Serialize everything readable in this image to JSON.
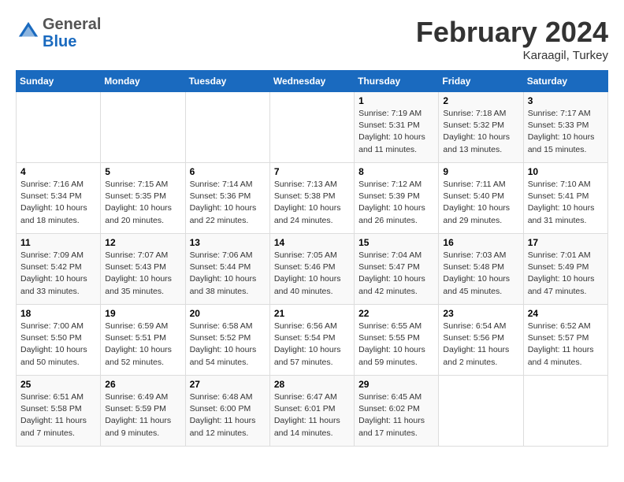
{
  "header": {
    "logo_line1": "General",
    "logo_line2": "Blue",
    "month_title": "February 2024",
    "location": "Karaagil, Turkey"
  },
  "days_of_week": [
    "Sunday",
    "Monday",
    "Tuesday",
    "Wednesday",
    "Thursday",
    "Friday",
    "Saturday"
  ],
  "weeks": [
    [
      {
        "num": "",
        "info": ""
      },
      {
        "num": "",
        "info": ""
      },
      {
        "num": "",
        "info": ""
      },
      {
        "num": "",
        "info": ""
      },
      {
        "num": "1",
        "info": "Sunrise: 7:19 AM\nSunset: 5:31 PM\nDaylight: 10 hours\nand 11 minutes."
      },
      {
        "num": "2",
        "info": "Sunrise: 7:18 AM\nSunset: 5:32 PM\nDaylight: 10 hours\nand 13 minutes."
      },
      {
        "num": "3",
        "info": "Sunrise: 7:17 AM\nSunset: 5:33 PM\nDaylight: 10 hours\nand 15 minutes."
      }
    ],
    [
      {
        "num": "4",
        "info": "Sunrise: 7:16 AM\nSunset: 5:34 PM\nDaylight: 10 hours\nand 18 minutes."
      },
      {
        "num": "5",
        "info": "Sunrise: 7:15 AM\nSunset: 5:35 PM\nDaylight: 10 hours\nand 20 minutes."
      },
      {
        "num": "6",
        "info": "Sunrise: 7:14 AM\nSunset: 5:36 PM\nDaylight: 10 hours\nand 22 minutes."
      },
      {
        "num": "7",
        "info": "Sunrise: 7:13 AM\nSunset: 5:38 PM\nDaylight: 10 hours\nand 24 minutes."
      },
      {
        "num": "8",
        "info": "Sunrise: 7:12 AM\nSunset: 5:39 PM\nDaylight: 10 hours\nand 26 minutes."
      },
      {
        "num": "9",
        "info": "Sunrise: 7:11 AM\nSunset: 5:40 PM\nDaylight: 10 hours\nand 29 minutes."
      },
      {
        "num": "10",
        "info": "Sunrise: 7:10 AM\nSunset: 5:41 PM\nDaylight: 10 hours\nand 31 minutes."
      }
    ],
    [
      {
        "num": "11",
        "info": "Sunrise: 7:09 AM\nSunset: 5:42 PM\nDaylight: 10 hours\nand 33 minutes."
      },
      {
        "num": "12",
        "info": "Sunrise: 7:07 AM\nSunset: 5:43 PM\nDaylight: 10 hours\nand 35 minutes."
      },
      {
        "num": "13",
        "info": "Sunrise: 7:06 AM\nSunset: 5:44 PM\nDaylight: 10 hours\nand 38 minutes."
      },
      {
        "num": "14",
        "info": "Sunrise: 7:05 AM\nSunset: 5:46 PM\nDaylight: 10 hours\nand 40 minutes."
      },
      {
        "num": "15",
        "info": "Sunrise: 7:04 AM\nSunset: 5:47 PM\nDaylight: 10 hours\nand 42 minutes."
      },
      {
        "num": "16",
        "info": "Sunrise: 7:03 AM\nSunset: 5:48 PM\nDaylight: 10 hours\nand 45 minutes."
      },
      {
        "num": "17",
        "info": "Sunrise: 7:01 AM\nSunset: 5:49 PM\nDaylight: 10 hours\nand 47 minutes."
      }
    ],
    [
      {
        "num": "18",
        "info": "Sunrise: 7:00 AM\nSunset: 5:50 PM\nDaylight: 10 hours\nand 50 minutes."
      },
      {
        "num": "19",
        "info": "Sunrise: 6:59 AM\nSunset: 5:51 PM\nDaylight: 10 hours\nand 52 minutes."
      },
      {
        "num": "20",
        "info": "Sunrise: 6:58 AM\nSunset: 5:52 PM\nDaylight: 10 hours\nand 54 minutes."
      },
      {
        "num": "21",
        "info": "Sunrise: 6:56 AM\nSunset: 5:54 PM\nDaylight: 10 hours\nand 57 minutes."
      },
      {
        "num": "22",
        "info": "Sunrise: 6:55 AM\nSunset: 5:55 PM\nDaylight: 10 hours\nand 59 minutes."
      },
      {
        "num": "23",
        "info": "Sunrise: 6:54 AM\nSunset: 5:56 PM\nDaylight: 11 hours\nand 2 minutes."
      },
      {
        "num": "24",
        "info": "Sunrise: 6:52 AM\nSunset: 5:57 PM\nDaylight: 11 hours\nand 4 minutes."
      }
    ],
    [
      {
        "num": "25",
        "info": "Sunrise: 6:51 AM\nSunset: 5:58 PM\nDaylight: 11 hours\nand 7 minutes."
      },
      {
        "num": "26",
        "info": "Sunrise: 6:49 AM\nSunset: 5:59 PM\nDaylight: 11 hours\nand 9 minutes."
      },
      {
        "num": "27",
        "info": "Sunrise: 6:48 AM\nSunset: 6:00 PM\nDaylight: 11 hours\nand 12 minutes."
      },
      {
        "num": "28",
        "info": "Sunrise: 6:47 AM\nSunset: 6:01 PM\nDaylight: 11 hours\nand 14 minutes."
      },
      {
        "num": "29",
        "info": "Sunrise: 6:45 AM\nSunset: 6:02 PM\nDaylight: 11 hours\nand 17 minutes."
      },
      {
        "num": "",
        "info": ""
      },
      {
        "num": "",
        "info": ""
      }
    ]
  ]
}
